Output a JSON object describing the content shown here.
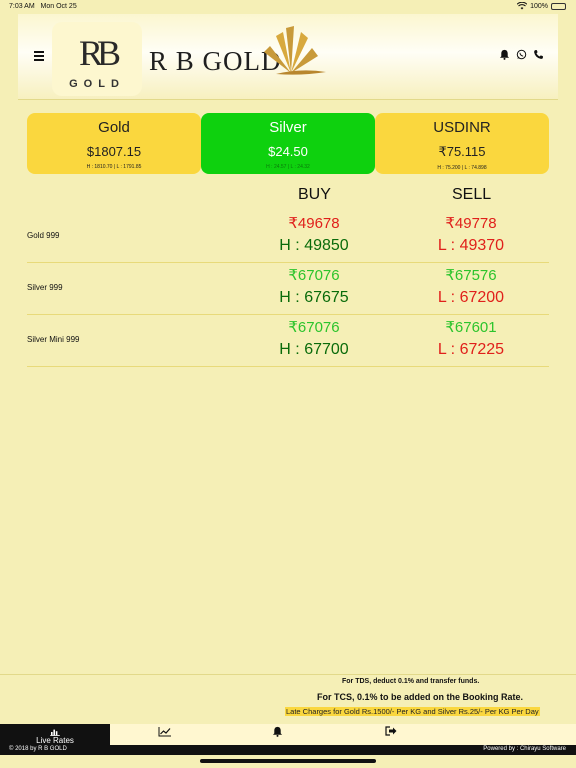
{
  "status": {
    "time": "7:03 AM",
    "date": "Mon Oct 25",
    "battery": "100%"
  },
  "header": {
    "logo_mono": "RB",
    "logo_sub": "GOLD",
    "brand": "R B GOLD"
  },
  "cards": [
    {
      "name": "Gold",
      "price": "$1807.15",
      "hl": "H : 1810.70 | L : 1791.85"
    },
    {
      "name": "Silver",
      "price": "$24.50",
      "hl": "H : 24.57 | L : 24.32"
    },
    {
      "name": "USDINR",
      "price": "₹75.115",
      "hl": "H : 75.200 | L : 74.898"
    }
  ],
  "rates": {
    "buy_label": "BUY",
    "sell_label": "SELL",
    "rows": [
      {
        "name": "Gold 999",
        "buy": "₹49678",
        "sell": "₹49778",
        "high": "H : 49850",
        "low": "L : 49370"
      },
      {
        "name": "Silver 999",
        "buy": "₹67076",
        "sell": "₹67576",
        "high": "H : 67675",
        "low": "L : 67200"
      },
      {
        "name": "Silver Mini 999",
        "buy": "₹67076",
        "sell": "₹67601",
        "high": "H : 67700",
        "low": "L : 67225"
      }
    ]
  },
  "notes": {
    "tds": "For TDS, deduct 0.1% and transfer funds.",
    "tcs": "For TCS, 0.1% to be added on the Booking Rate.",
    "late": "Late Charges for Gold Rs.1500/- Per KG and Silver Rs.25/- Per KG Per Day"
  },
  "tabs": {
    "live_rates": "Live Rates"
  },
  "footer": {
    "copyright": "© 2018 by R B GOLD",
    "powered": "Powered by : Chirayu Software"
  },
  "colors": {
    "background": "#f5efb6",
    "gold_card": "#fad73e",
    "silver_card": "#0ed10e",
    "price_red": "#e0201b",
    "price_green": "#2cc42c",
    "high_green": "#0a6b0a"
  },
  "icons": [
    "wifi-icon",
    "battery-icon",
    "menu-icon",
    "bell-icon",
    "whatsapp-icon",
    "phone-icon",
    "bar-chart-icon",
    "line-chart-icon",
    "notification-icon",
    "logout-icon"
  ]
}
